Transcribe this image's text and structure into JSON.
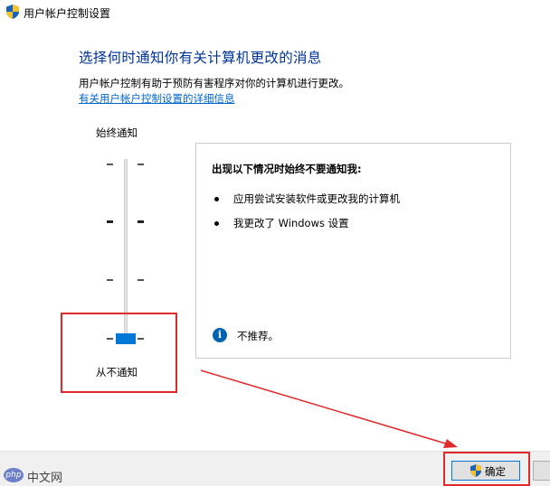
{
  "window": {
    "title": "用户帐户控制设置",
    "title_icon": "uac-shield-icon"
  },
  "main": {
    "heading": "选择何时通知你有关计算机更改的消息",
    "description": "用户帐户控制有助于预防有害程序对你的计算机进行更改。",
    "link": "有关用户帐户控制设置的详细信息"
  },
  "slider": {
    "top_label": "始终通知",
    "bottom_label": "从不通知",
    "levels": 4,
    "selected_level": 1
  },
  "info_panel": {
    "heading": "出现以下情况时始终不要通知我:",
    "bullets": [
      "应用尝试安装软件或更改我的计算机",
      "我更改了 Windows 设置"
    ],
    "note": "不推荐。",
    "note_icon": "info-icon"
  },
  "footer": {
    "ok_label": "确定",
    "ok_icon": "uac-shield-icon"
  },
  "watermark": {
    "text": "中文网",
    "logo_text": "php"
  },
  "colors": {
    "heading": "#003399",
    "link": "#0066cc",
    "thumb": "#0078d7",
    "annotation": "#e0292b",
    "info_icon": "#0063b1"
  }
}
